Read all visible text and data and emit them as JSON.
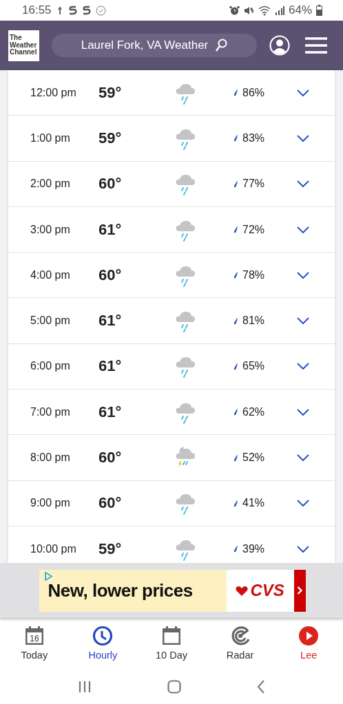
{
  "status_bar": {
    "time": "16:55",
    "battery": "64%"
  },
  "header": {
    "logo": "The Weather Channel",
    "search": "Laurel Fork, VA Weather"
  },
  "hours": [
    {
      "time": "12:00 pm",
      "temp": "59°",
      "kind": "rain",
      "precip": "86%"
    },
    {
      "time": "1:00 pm",
      "temp": "59°",
      "kind": "rain",
      "precip": "83%"
    },
    {
      "time": "2:00 pm",
      "temp": "60°",
      "kind": "rain",
      "precip": "77%"
    },
    {
      "time": "3:00 pm",
      "temp": "61°",
      "kind": "rain",
      "precip": "72%"
    },
    {
      "time": "4:00 pm",
      "temp": "60°",
      "kind": "rain",
      "precip": "78%"
    },
    {
      "time": "5:00 pm",
      "temp": "61°",
      "kind": "rain",
      "precip": "81%"
    },
    {
      "time": "6:00 pm",
      "temp": "61°",
      "kind": "rain",
      "precip": "65%"
    },
    {
      "time": "7:00 pm",
      "temp": "61°",
      "kind": "rain",
      "precip": "62%"
    },
    {
      "time": "8:00 pm",
      "temp": "60°",
      "kind": "storm",
      "precip": "52%"
    },
    {
      "time": "9:00 pm",
      "temp": "60°",
      "kind": "rain",
      "precip": "41%"
    },
    {
      "time": "10:00 pm",
      "temp": "59°",
      "kind": "rain",
      "precip": "39%"
    }
  ],
  "ad": {
    "headline": "New, lower prices",
    "brand": "CVS"
  },
  "nav": [
    {
      "label": "Today",
      "kind": "today",
      "selected": false,
      "date": "16"
    },
    {
      "label": "Hourly",
      "kind": "hourly",
      "selected": true
    },
    {
      "label": "10 Day",
      "kind": "tenday",
      "selected": false
    },
    {
      "label": "Radar",
      "kind": "radar",
      "selected": false
    },
    {
      "label": "Lee",
      "kind": "video",
      "selected": false
    }
  ]
}
